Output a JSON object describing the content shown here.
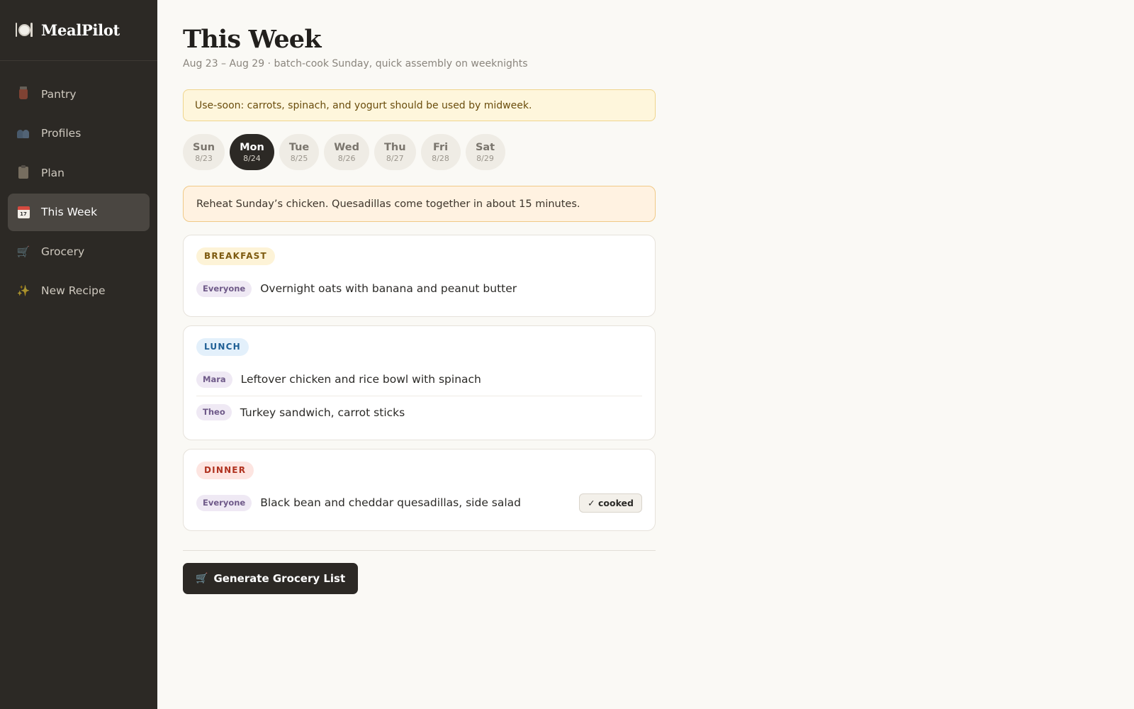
{
  "app": {
    "name": "MealPilot",
    "logo_icon": "plate-cutlery-icon"
  },
  "sidebar": {
    "items": [
      {
        "label": "Pantry",
        "icon": "jar-icon",
        "active": false
      },
      {
        "label": "Profiles",
        "icon": "people-icon",
        "active": false
      },
      {
        "label": "Plan",
        "icon": "clipboard-icon",
        "active": false
      },
      {
        "label": "This Week",
        "icon": "calendar-icon",
        "active": true,
        "icon_text": "17"
      },
      {
        "label": "Grocery",
        "icon": "cart-icon",
        "active": false
      },
      {
        "label": "New Recipe",
        "icon": "sparkles-icon",
        "active": false
      }
    ]
  },
  "page": {
    "title": "This Week",
    "subtitle": "Aug 23 – Aug 29 · batch-cook Sunday, quick assembly on weeknights"
  },
  "use_soon_alert": "Use-soon: carrots, spinach, and yogurt should be used by midweek.",
  "days": [
    {
      "name": "Sun",
      "date": "8/23"
    },
    {
      "name": "Mon",
      "date": "8/24",
      "selected": true
    },
    {
      "name": "Tue",
      "date": "8/25"
    },
    {
      "name": "Wed",
      "date": "8/26"
    },
    {
      "name": "Thu",
      "date": "8/27"
    },
    {
      "name": "Fri",
      "date": "8/28"
    },
    {
      "name": "Sat",
      "date": "8/29"
    }
  ],
  "day_tip": "Reheat Sunday’s chicken. Quesadillas come together in about 15 minutes.",
  "meals": {
    "breakfast": {
      "label": "BREAKFAST",
      "rows": [
        {
          "who": "Everyone",
          "text": "Overnight oats with banana and peanut butter"
        }
      ]
    },
    "lunch": {
      "label": "LUNCH",
      "rows": [
        {
          "who": "Mara",
          "text": "Leftover chicken and rice bowl with spinach"
        },
        {
          "who": "Theo",
          "text": "Turkey sandwich, carrot sticks"
        }
      ]
    },
    "dinner": {
      "label": "DINNER",
      "rows": [
        {
          "who": "Everyone",
          "text": "Black bean and cheddar quesadillas, side salad",
          "status": "✓ cooked"
        }
      ]
    }
  },
  "actions": {
    "generate_grocery": "Generate Grocery List",
    "generate_icon": "cart-icon"
  },
  "colors": {
    "sidebar_bg": "#2c2925",
    "page_bg": "#faf9f5",
    "use_soon_bg": "#fef6dc",
    "tip_bg": "#fff2e1",
    "breakfast_accent": "#7d5a0f",
    "lunch_accent": "#1f5f95",
    "dinner_accent": "#b0321f",
    "who_tag": "#6f5a89"
  }
}
